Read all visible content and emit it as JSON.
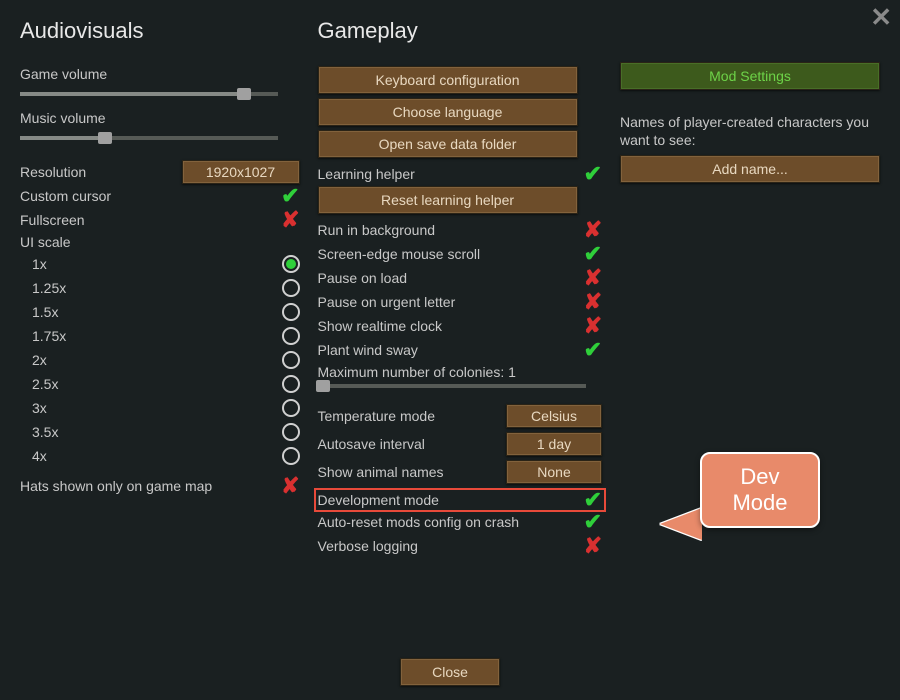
{
  "audiovisuals": {
    "title": "Audiovisuals",
    "game_volume_label": "Game volume",
    "game_volume_pct": 87,
    "music_volume_label": "Music volume",
    "music_volume_pct": 33,
    "resolution_label": "Resolution",
    "resolution_value": "1920x1027",
    "custom_cursor_label": "Custom cursor",
    "custom_cursor": true,
    "fullscreen_label": "Fullscreen",
    "fullscreen": false,
    "ui_scale_label": "UI scale",
    "ui_scale_options": [
      "1x",
      "1.25x",
      "1.5x",
      "1.75x",
      "2x",
      "2.5x",
      "3x",
      "3.5x",
      "4x"
    ],
    "ui_scale_selected_index": 0,
    "hats_label": "Hats shown only on game map",
    "hats": false
  },
  "gameplay": {
    "title": "Gameplay",
    "btn_keyboard": "Keyboard configuration",
    "btn_language": "Choose language",
    "btn_savefolder": "Open save data folder",
    "learning_helper_label": "Learning helper",
    "learning_helper": true,
    "btn_reset_learning": "Reset learning helper",
    "run_bg_label": "Run in background",
    "run_bg": false,
    "edge_scroll_label": "Screen-edge mouse scroll",
    "edge_scroll": true,
    "pause_load_label": "Pause on load",
    "pause_load": false,
    "pause_letter_label": "Pause on urgent letter",
    "pause_letter": false,
    "realtime_clock_label": "Show realtime clock",
    "realtime_clock": false,
    "wind_sway_label": "Plant wind sway",
    "wind_sway": true,
    "max_colonies_label": "Maximum number of colonies: 1",
    "max_colonies_pct": 2,
    "temp_mode_label": "Temperature mode",
    "temp_mode_value": "Celsius",
    "autosave_label": "Autosave interval",
    "autosave_value": "1 day",
    "animal_names_label": "Show animal names",
    "animal_names_value": "None",
    "dev_mode_label": "Development mode",
    "dev_mode": true,
    "reset_mods_label": "Auto-reset mods config on crash",
    "reset_mods": true,
    "verbose_label": "Verbose logging",
    "verbose": false
  },
  "mods": {
    "btn_mod_settings": "Mod Settings",
    "names_text": "Names of player-created characters you want to see:",
    "btn_add_name": "Add name..."
  },
  "callout": {
    "line1": "Dev",
    "line2": "Mode"
  },
  "footer": {
    "close": "Close"
  }
}
